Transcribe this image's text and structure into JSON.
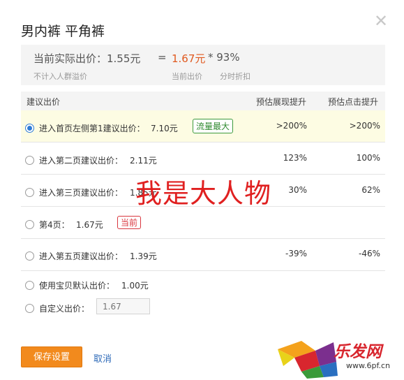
{
  "dialog": {
    "title": "男内裤 平角裤",
    "close_glyph": "✕"
  },
  "summary": {
    "label": "当前实际出价：1.55元",
    "equals": "=",
    "current_price": "1.67元",
    "multiplier": "* 93%",
    "note_left": "不计入人群溢价",
    "note_price": "当前出价",
    "note_discount": "分时折扣"
  },
  "table": {
    "headers": {
      "bid": "建议出价",
      "show": "预估展现提升",
      "click": "预估点击提升"
    },
    "rows": [
      {
        "label": "进入首页左侧第1建议出价：",
        "price": "7.10元",
        "tag": "流量最大",
        "show": ">200%",
        "click": ">200%",
        "selected": true
      },
      {
        "label": "进入第二页建议出价：",
        "price": "2.11元",
        "tag": "",
        "show": "123%",
        "click": "100%",
        "selected": false
      },
      {
        "label": "进入第三页建议出价：",
        "price": "1.85元",
        "tag": "",
        "show": "30%",
        "click": "62%",
        "selected": false
      },
      {
        "label": "第4页：",
        "price": "1.67元",
        "tag": "当前",
        "show": "",
        "click": "",
        "selected": false
      },
      {
        "label": "进入第五页建议出价：",
        "price": "1.39元",
        "tag": "",
        "show": "-39%",
        "click": "-46%",
        "selected": false
      },
      {
        "label": "使用宝贝默认出价：",
        "price": "1.00元",
        "tag": "",
        "show": "",
        "click": "",
        "selected": false
      },
      {
        "label": "自定义出价：",
        "price": "",
        "tag": "",
        "show": "",
        "click": "",
        "selected": false
      }
    ],
    "custom_placeholder": "1.67"
  },
  "overlay_text": "我是大人物",
  "actions": {
    "save": "保存设置",
    "cancel": "取消"
  },
  "watermark": {
    "name": "乐发网",
    "url": "www.6pf.cn"
  },
  "colors": {
    "accent": "#f28a1d",
    "price_orange": "#e0591f",
    "selected_row": "#fdfce3",
    "radio_blue": "#2e7bd6",
    "tag_green": "#3d9a3d",
    "tag_red": "#d9363e"
  }
}
